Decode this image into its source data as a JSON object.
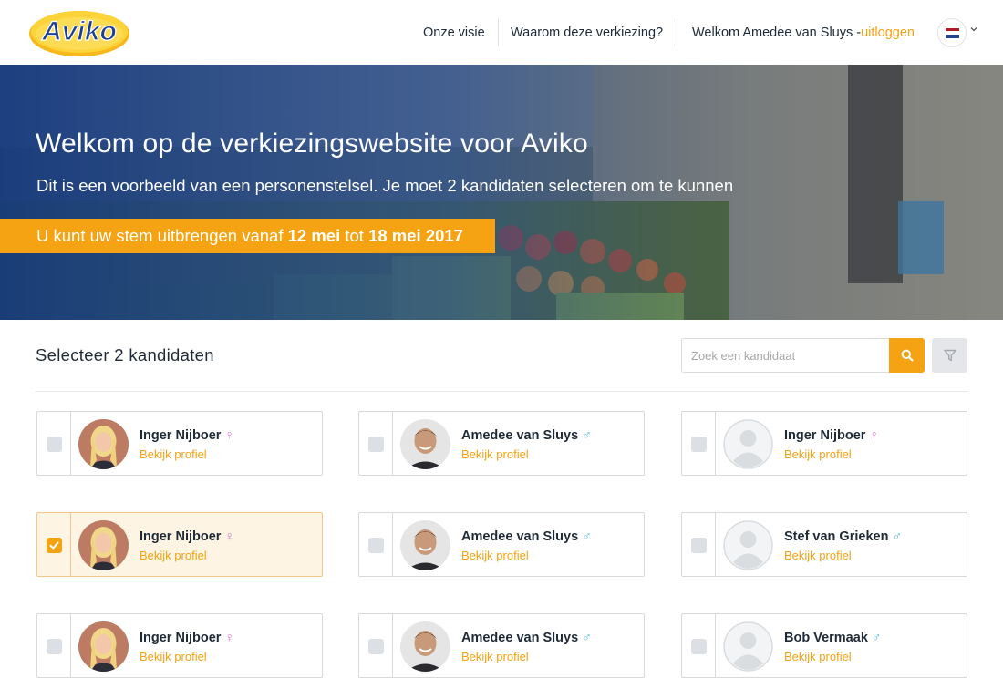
{
  "header": {
    "brand": "Aviko",
    "nav": [
      "Onze visie",
      "Waarom deze verkiezing?"
    ],
    "welcome": "Welkom Amedee van Sluys - ",
    "logout": "uitloggen",
    "language_icon": "flag-nl-icon",
    "flag_colors": [
      "#ae1c28",
      "#ffffff",
      "#21468b"
    ]
  },
  "hero": {
    "title": "Welkom op de verkiezingswebsite voor Aviko",
    "subtitle": "Dit is een voorbeeld van een personenstelsel. Je moet 2 kandidaten selecteren om te kunnen",
    "banner_prefix": "U kunt uw stem uitbrengen vanaf ",
    "banner_start": "12 mei",
    "banner_mid": " tot ",
    "banner_end": "18 mei 2017"
  },
  "selection": {
    "title": "Selecteer 2 kandidaten",
    "search_placeholder": "Zoek een kandidaat",
    "search_icon": "search-icon",
    "filter_icon": "filter-icon"
  },
  "colors": {
    "accent": "#f5a312",
    "text": "#1f2a37",
    "female": "#d873c9",
    "male": "#55b6e6"
  },
  "candidates": [
    {
      "name": "Inger Nijboer",
      "gender": "♀",
      "link": "Bekijk profiel",
      "selected": false,
      "avatar": "woman"
    },
    {
      "name": "Amedee van Sluys",
      "gender": "♂",
      "link": "Bekijk profiel",
      "selected": false,
      "avatar": "man"
    },
    {
      "name": "Inger Nijboer",
      "gender": "♀",
      "link": "Bekijk profiel",
      "selected": false,
      "avatar": "placeholder"
    },
    {
      "name": "Inger Nijboer",
      "gender": "♀",
      "link": "Bekijk profiel",
      "selected": true,
      "avatar": "woman"
    },
    {
      "name": "Amedee van Sluys",
      "gender": "♂",
      "link": "Bekijk profiel",
      "selected": false,
      "avatar": "man"
    },
    {
      "name": "Stef van Grieken",
      "gender": "♂",
      "link": "Bekijk profiel",
      "selected": false,
      "avatar": "placeholder"
    },
    {
      "name": "Inger Nijboer",
      "gender": "♀",
      "link": "Bekijk profiel",
      "selected": false,
      "avatar": "woman"
    },
    {
      "name": "Amedee van Sluys",
      "gender": "♂",
      "link": "Bekijk profiel",
      "selected": false,
      "avatar": "man"
    },
    {
      "name": "Bob Vermaak",
      "gender": "♂",
      "link": "Bekijk profiel",
      "selected": false,
      "avatar": "placeholder"
    }
  ]
}
